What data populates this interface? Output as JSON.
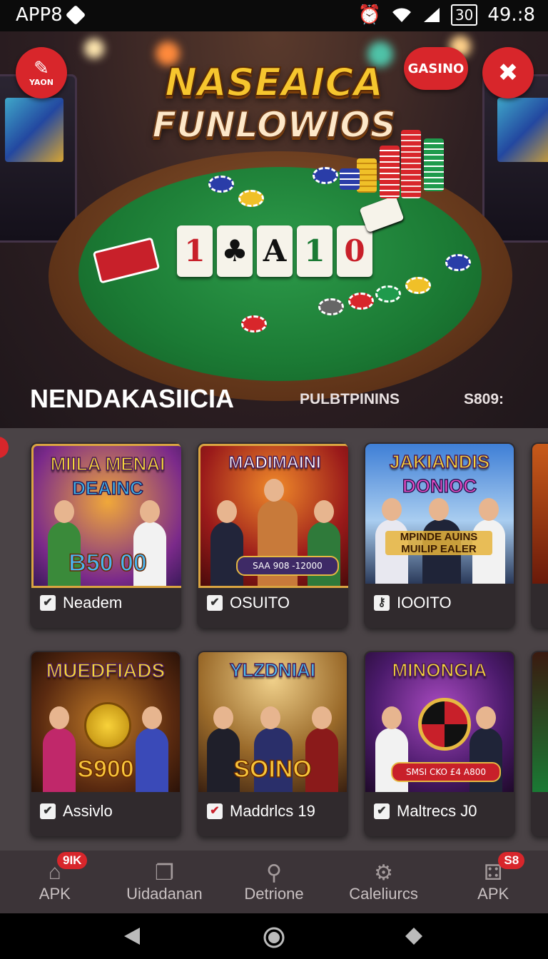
{
  "status_bar": {
    "app_label": "APP8",
    "battery": "30",
    "time": "49.:8"
  },
  "hero": {
    "title_line1": "NASEAICA",
    "title_line2": "FUNLOWIOS",
    "left_button_label": "YAON",
    "casino_button_label": "GASINO",
    "cards": [
      "1",
      "♣",
      "A",
      "1",
      "0"
    ]
  },
  "section": {
    "title": "NENDAKASIICIA",
    "tab1": "PULBTPININS",
    "tab2": "S809:"
  },
  "games": [
    {
      "title": "MIILA MENAI",
      "subtitle": "DEAINC",
      "amount": "B50 00",
      "label": "Neadem"
    },
    {
      "title": "MADIMAINI",
      "subtitle": "",
      "amount": "SAA 908 -12000",
      "label": "OSUITO"
    },
    {
      "title": "JAKIANDIS",
      "subtitle": "DONIOC",
      "amount": "MPINDE AUINS MUILIP EALER",
      "label": "IOOITO"
    },
    {
      "title": "MUEDFIADS",
      "subtitle": "",
      "amount": "S900",
      "label": "Assivlo"
    },
    {
      "title": "YLZDNIAI",
      "subtitle": "",
      "amount": "SOINO",
      "label": "Maddrlcs 19"
    },
    {
      "title": "MINONGIA",
      "subtitle": "",
      "amount": "SMSI CKO £4 A800",
      "label": "Maltrecs J0"
    }
  ],
  "nav": [
    {
      "label": "APK",
      "badge": "9IK",
      "icon": "home-icon"
    },
    {
      "label": "Uidadanan",
      "badge": "",
      "icon": "stack-icon"
    },
    {
      "label": "Detrione",
      "badge": "",
      "icon": "search-icon"
    },
    {
      "label": "Caleliurcs",
      "badge": "",
      "icon": "settings-icon"
    },
    {
      "label": "APK",
      "badge": "S8",
      "icon": "apps-icon"
    }
  ],
  "colors": {
    "accent": "#d8262b",
    "felt": "#1b7a34",
    "gold": "#f6c62e"
  }
}
